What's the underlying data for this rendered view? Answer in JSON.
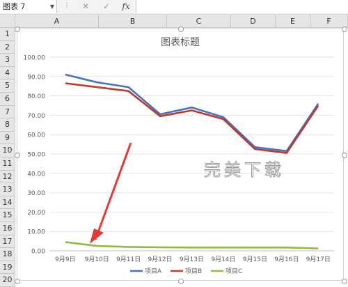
{
  "formula_bar": {
    "name_box": "图表 7",
    "cancel_icon": "✕",
    "confirm_icon": "✓",
    "fx_label": "fx"
  },
  "columns": [
    "A",
    "B",
    "C",
    "D",
    "E",
    "F"
  ],
  "rows": [
    "1",
    "2",
    "3",
    "4",
    "5",
    "6",
    "7",
    "8",
    "9",
    "10",
    "11",
    "12",
    "13",
    "14",
    "15",
    "16",
    "17",
    "18",
    "19",
    "20"
  ],
  "watermark": "完美下载",
  "colors": {
    "series_a": "#4472c4",
    "series_b": "#c0392b",
    "series_c": "#8fbc3a",
    "arrow": "#e53935"
  },
  "chart_data": {
    "type": "line",
    "title": "图表标题",
    "categories": [
      "9月9日",
      "9月10日",
      "9月11日",
      "9月12日",
      "9月13日",
      "9月14日",
      "9月15日",
      "9月16日",
      "9月17日"
    ],
    "series": [
      {
        "name": "项目A",
        "values": [
          91,
          87,
          84.5,
          70.5,
          74,
          69,
          53.5,
          51.5,
          76
        ]
      },
      {
        "name": "项目B",
        "values": [
          86.5,
          84.5,
          82.5,
          69.5,
          72.5,
          68,
          52.5,
          50.5,
          75
        ]
      },
      {
        "name": "项目C",
        "values": [
          4.5,
          2.5,
          2,
          1.8,
          1.7,
          1.7,
          1.7,
          1.7,
          1.2
        ]
      }
    ],
    "ylim": [
      0,
      100
    ],
    "yticks": [
      "0.00",
      "10.00",
      "20.00",
      "30.00",
      "40.00",
      "50.00",
      "60.00",
      "70.00",
      "80.00",
      "90.00",
      "100.00"
    ],
    "grid": true,
    "legend": "bottom"
  }
}
